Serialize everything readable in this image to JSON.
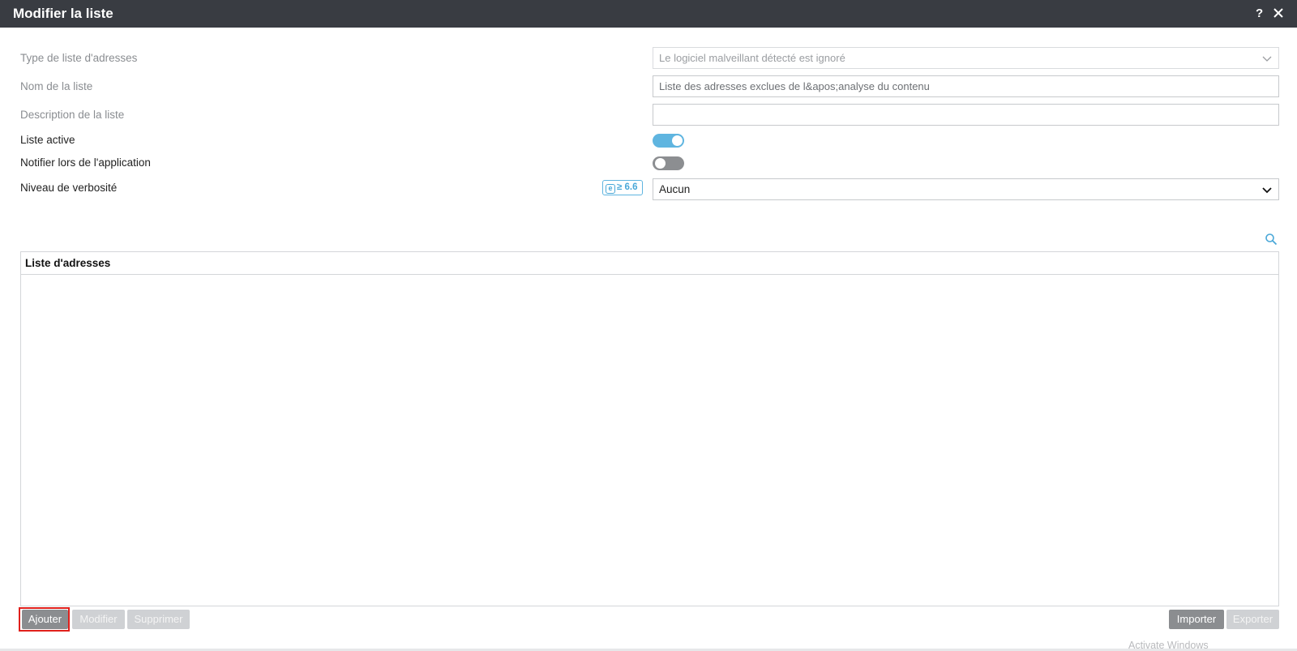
{
  "window": {
    "title": "Modifier la liste",
    "help_label": "?"
  },
  "form": {
    "address_list_type": {
      "label": "Type de liste d'adresses",
      "value": "Le logiciel malveillant détecté est ignoré"
    },
    "list_name": {
      "label": "Nom de la liste",
      "value": "Liste des adresses exclues de l&apos;analyse du contenu"
    },
    "list_description": {
      "label": "Description de la liste",
      "value": ""
    },
    "list_active": {
      "label": "Liste active",
      "state": "on"
    },
    "notify_on_apply": {
      "label": "Notifier lors de l'application",
      "state": "off"
    },
    "verbosity": {
      "label": "Niveau de verbosité",
      "badge_icon": "e",
      "badge_text": "≥ 6.6",
      "value": "Aucun"
    }
  },
  "table": {
    "column_header": "Liste d'adresses",
    "rows": []
  },
  "actions": {
    "add_label": "Ajouter",
    "modify_label": "Modifier",
    "delete_label": "Supprimer",
    "import_label": "Importer",
    "export_label": "Exporter"
  },
  "overlay": {
    "watermark": "Activate Windows"
  },
  "colors": {
    "titlebar": "#393c42",
    "accent": "#5fb5e0",
    "highlight": "#e0201c"
  }
}
